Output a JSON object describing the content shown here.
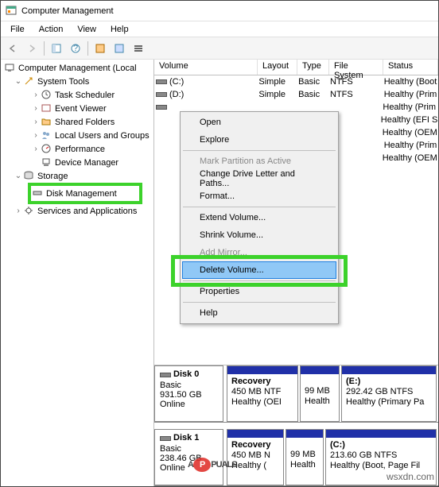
{
  "title": "Computer Management",
  "menubar": {
    "file": "File",
    "action": "Action",
    "view": "View",
    "help": "Help"
  },
  "tree": {
    "root": "Computer Management (Local",
    "system_tools": "System Tools",
    "task_scheduler": "Task Scheduler",
    "event_viewer": "Event Viewer",
    "shared_folders": "Shared Folders",
    "local_users": "Local Users and Groups",
    "performance": "Performance",
    "device_manager": "Device Manager",
    "storage": "Storage",
    "disk_management": "Disk Management",
    "services": "Services and Applications"
  },
  "columns": {
    "volume": "Volume",
    "layout": "Layout",
    "type": "Type",
    "fs": "File System",
    "status": "Status"
  },
  "volumes": [
    {
      "name": "(C:)",
      "layout": "Simple",
      "type": "Basic",
      "fs": "NTFS",
      "status": "Healthy (Boot"
    },
    {
      "name": "(D:)",
      "layout": "Simple",
      "type": "Basic",
      "fs": "NTFS",
      "status": "Healthy (Prim"
    },
    {
      "name": "",
      "layout": "",
      "type": "",
      "fs": "",
      "status": "Healthy (Prim"
    },
    {
      "name": "",
      "layout": "",
      "type": "",
      "fs": "",
      "status": "Healthy (EFI S"
    },
    {
      "name": "",
      "layout": "",
      "type": "",
      "fs": "",
      "status": "Healthy (OEM"
    },
    {
      "name": "",
      "layout": "",
      "type": "",
      "fs": "",
      "status": "Healthy (Prim"
    },
    {
      "name": "",
      "layout": "",
      "type": "",
      "fs": "",
      "status": "Healthy (OEM"
    }
  ],
  "ctx": {
    "open": "Open",
    "explore": "Explore",
    "mark": "Mark Partition as Active",
    "change": "Change Drive Letter and Paths...",
    "format": "Format...",
    "extend": "Extend Volume...",
    "shrink": "Shrink Volume...",
    "mirror": "Add Mirror...",
    "delete": "Delete Volume...",
    "props": "Properties",
    "help": "Help"
  },
  "disks": [
    {
      "title": "Disk 0",
      "kind": "Basic",
      "size": "931.50 GB",
      "state": "Online",
      "parts": [
        {
          "name": "Recovery",
          "l2": "450 MB NTF",
          "l3": "Healthy (OEI",
          "w": 90
        },
        {
          "name": "",
          "l2": "99 MB",
          "l3": "Health",
          "w": 50
        },
        {
          "name": "(E:)",
          "l2": "292.42 GB NTFS",
          "l3": "Healthy (Primary Pa",
          "w": 150
        }
      ]
    },
    {
      "title": "Disk 1",
      "kind": "Basic",
      "size": "238.46 GB",
      "state": "Online",
      "parts": [
        {
          "name": "Recovery",
          "l2": "450 MB N",
          "l3": "Healthy (",
          "w": 72
        },
        {
          "name": "",
          "l2": "99 MB",
          "l3": "Health",
          "w": 48
        },
        {
          "name": "(C:)",
          "l2": "213.60 GB NTFS",
          "l3": "Healthy (Boot, Page Fil",
          "w": 160
        }
      ]
    }
  ],
  "watermark": "wsxdn.com",
  "logo": {
    "a": "A",
    "p": "P",
    "rest": "PUALS"
  }
}
